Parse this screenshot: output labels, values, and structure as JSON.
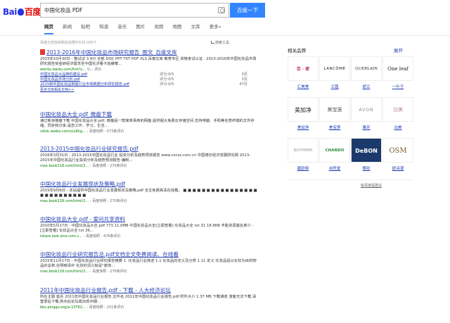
{
  "logo": {
    "text_bai": "Bai",
    "text_du": "百度"
  },
  "search": {
    "value": "中国化妆品 PDF",
    "button": "百度一下"
  },
  "nav": {
    "tabs": [
      "网页",
      "新闻",
      "贴吧",
      "知道",
      "音乐",
      "图片",
      "视频",
      "地图",
      "文库",
      "更多»"
    ]
  },
  "stats": {
    "text": "百度为您找到相关结果约535,000个",
    "tools": "搜索工具"
  },
  "results": [
    {
      "title": "2013-2016年中国化妆品市场研究报告_图文_百度文库",
      "snippet": "2015年10月30日 - 整试试 3.9分 全部 DOC PPT TXT PDF XLS 百度文库 教育专区 资格考试认证 . 2013-2016年中国化妆品市场研究报告受金转经济置苏至中国化济看卡始缓筹...",
      "url": "wenku.baidu.com/link?u...",
      "url_extra": "V₁ - 评价",
      "subs": [
        {
          "link": "中国化妆品大品牌的建设.pdf",
          "rating": "评分:0/5",
          "pages": "3页"
        },
        {
          "link": "中国化妆品市场分析.pdf",
          "rating": "评分:0/5",
          "pages": "3页"
        },
        {
          "link": "2015新中国化妆品制造行业市场数据分析研究报告.pdf",
          "rating": "评分:0/5",
          "pages": "47页"
        }
      ],
      "more": "更多文库相关文档>>"
    },
    {
      "title": "中国化妆品大全.pdf_微盘下载",
      "snippet": "通过新浪微盘下载 中国化妆品大全.pdf, 微盘是一款简单易用的网盘,提供超大免费云存储空间,支持电脑、手机等任意终端的文件存储、同步和分享,是您工作、学习、生活...",
      "url": "vdisk.weibo.com/s/uKkg...",
      "url_extra": "- 百度快照 - 573条评价"
    },
    {
      "title": "2013-2015中国化妆品行业研究报告.pdf",
      "snippet": "2016年3月31日 - 2013-2015中国化妆品行业 投资分析及趋势预测报告 www.cecsz.com.cn 中国博亦经济发展研究网 2013-2015年中国化妆品行业投资分析及趋势预测报告 编制...",
      "url": "max.book118.com/html/2...",
      "url_extra": "- 百度快照 - 270条评价"
    },
    {
      "title": "中国化妆品行业发展现状及策略.pdf",
      "snippet": "2015年9月6日 - 本站提供中国化妆品行业发展现状及策略.pdf 全文免费高清在线看。 ■ ■ ■ ■ ■ ■ ■ ■ ■ ■ ■ ■ ■ ■ ■ ■ ■ ■ ■ ■ ■ ■ ■ ■ ■ ■",
      "url": "max.book118.com/html/2...",
      "url_extra": "- 百度快照 - 270条评价"
    },
    {
      "title": "中国化妆品大全.pdf - 爱问共享资料",
      "snippet": "2010年5月17日 - 中国化妆品大全.pdf 773.11.0MB 中国化妆品大全[立即查看] 化妆品大全 txt 31 18.8KB 丰能资源富名单介 - [立即查看] 化妆品大全 txt 36...",
      "url": "ishare.iask.sina.com.c...",
      "url_extra": "- 百度快照 - 476条评价"
    },
    {
      "title": "中国化妆品行业研究报告总.pdf文档全文免费阅读、在线看",
      "snippet": "2015年11月17日 - 中国化妆品行业研究报告摘要 1. 化妆品行业简述 1.1 化妆品的定义及分类 1.11 定义 化妆品是以化妆为目的物品的总称,在明晰译中 化妆的词义就是\"装饰...",
      "url": "max.book118.com/html/2...",
      "url_extra": "- 百度快照 - 270条评价"
    },
    {
      "title": "2011年中国化妆品行业报告.pdf - 下载 - 人大经济论坛",
      "snippet": "所在主题 首页 2011年中国化妆品行业报告 文件名 2011年中国化妆品行业报告.pdf 附件大小 1.37 MB 下载通道 游客无法下载,请登录后下载,购买后论坛或出现中期...",
      "url": "bbs.pinggu.org/a-10762...",
      "url_extra": "- 百度快照 - 151条评价"
    }
  ],
  "sidebar": {
    "heading": "相关品牌",
    "expand": "展开",
    "brands": [
      {
        "logo": "百 · 家",
        "name": "汇美美"
      },
      {
        "logo": "LANCÔME",
        "name": "兰蔻"
      },
      {
        "logo": "GUERLAIN",
        "name": "娇兰"
      },
      {
        "logo": "One leaf",
        "name": "一叶子"
      },
      {
        "logo": "美加净",
        "name": "美加净"
      },
      {
        "logo": "美宝莲",
        "name": "美宝莲"
      },
      {
        "logo": "AVON",
        "name": "雅芳"
      },
      {
        "logo": "泊美",
        "name": "泊美"
      },
      {
        "logo": "BIOTHERM",
        "name": "碧欧泉"
      },
      {
        "logo": "CHANDO",
        "name": "自然堂"
      },
      {
        "logo": "DeBON",
        "name": "蝶妆"
      },
      {
        "logo": "OSM",
        "name": "欧诗漫"
      }
    ],
    "feedback": "给百度提建议"
  }
}
